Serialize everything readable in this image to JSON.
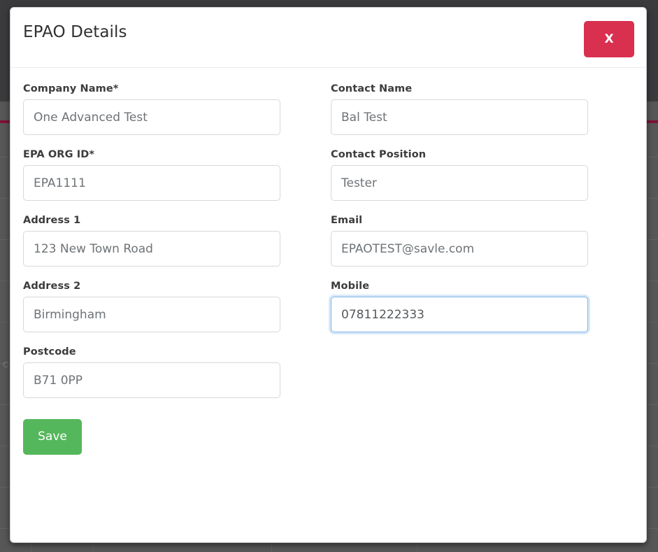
{
  "background": {
    "accent_color": "#7c1336",
    "overlay_color": "#575757",
    "navbar_color": "#3b3b3d",
    "ghost_cell_text": "C"
  },
  "modal": {
    "title": "EPAO Details",
    "close_label": "X",
    "close_color": "#d9304f",
    "save": {
      "label": "Save",
      "color": "#55b75b"
    },
    "focus_color": "#7db6e8",
    "left_column": [
      {
        "key": "company_name",
        "label": "Company Name*",
        "value": "One Advanced Test",
        "placeholder": "Company Name",
        "focused": false
      },
      {
        "key": "epa_org_id",
        "label": "EPA ORG ID*",
        "value": "EPA1111",
        "placeholder": "EPA ORG ID",
        "focused": false
      },
      {
        "key": "address_1",
        "label": "Address 1",
        "value": "123 New Town Road",
        "placeholder": "Address 1",
        "focused": false
      },
      {
        "key": "address_2",
        "label": "Address 2",
        "value": "Birmingham",
        "placeholder": "Address 2",
        "focused": false
      },
      {
        "key": "postcode",
        "label": "Postcode",
        "value": "B71 0PP",
        "placeholder": "Postcode",
        "focused": false
      }
    ],
    "right_column": [
      {
        "key": "contact_name",
        "label": "Contact Name",
        "value": "Bal Test",
        "placeholder": "Contact Name",
        "focused": false
      },
      {
        "key": "contact_position",
        "label": "Contact Position",
        "value": "Tester",
        "placeholder": "Contact Position",
        "focused": false
      },
      {
        "key": "email",
        "label": "Email",
        "value": "EPAOTEST@savle.com",
        "placeholder": "Email",
        "focused": false
      },
      {
        "key": "mobile",
        "label": "Mobile",
        "value": "07811222333",
        "placeholder": "Mobile",
        "focused": true
      }
    ]
  }
}
